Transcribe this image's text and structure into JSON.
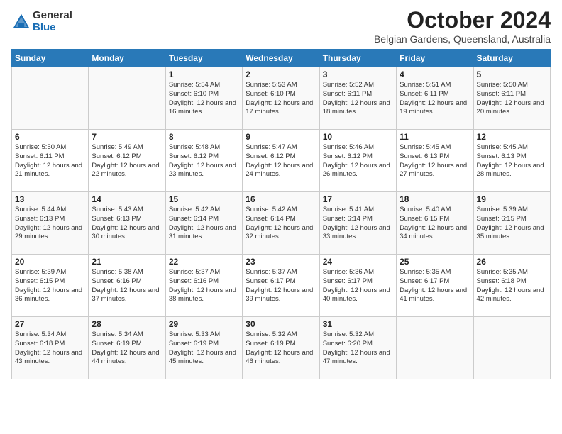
{
  "logo": {
    "general": "General",
    "blue": "Blue"
  },
  "header": {
    "month": "October 2024",
    "location": "Belgian Gardens, Queensland, Australia"
  },
  "weekdays": [
    "Sunday",
    "Monday",
    "Tuesday",
    "Wednesday",
    "Thursday",
    "Friday",
    "Saturday"
  ],
  "weeks": [
    [
      {
        "day": "",
        "info": ""
      },
      {
        "day": "",
        "info": ""
      },
      {
        "day": "1",
        "info": "Sunrise: 5:54 AM\nSunset: 6:10 PM\nDaylight: 12 hours and 16 minutes."
      },
      {
        "day": "2",
        "info": "Sunrise: 5:53 AM\nSunset: 6:10 PM\nDaylight: 12 hours and 17 minutes."
      },
      {
        "day": "3",
        "info": "Sunrise: 5:52 AM\nSunset: 6:11 PM\nDaylight: 12 hours and 18 minutes."
      },
      {
        "day": "4",
        "info": "Sunrise: 5:51 AM\nSunset: 6:11 PM\nDaylight: 12 hours and 19 minutes."
      },
      {
        "day": "5",
        "info": "Sunrise: 5:50 AM\nSunset: 6:11 PM\nDaylight: 12 hours and 20 minutes."
      }
    ],
    [
      {
        "day": "6",
        "info": "Sunrise: 5:50 AM\nSunset: 6:11 PM\nDaylight: 12 hours and 21 minutes."
      },
      {
        "day": "7",
        "info": "Sunrise: 5:49 AM\nSunset: 6:12 PM\nDaylight: 12 hours and 22 minutes."
      },
      {
        "day": "8",
        "info": "Sunrise: 5:48 AM\nSunset: 6:12 PM\nDaylight: 12 hours and 23 minutes."
      },
      {
        "day": "9",
        "info": "Sunrise: 5:47 AM\nSunset: 6:12 PM\nDaylight: 12 hours and 24 minutes."
      },
      {
        "day": "10",
        "info": "Sunrise: 5:46 AM\nSunset: 6:12 PM\nDaylight: 12 hours and 26 minutes."
      },
      {
        "day": "11",
        "info": "Sunrise: 5:45 AM\nSunset: 6:13 PM\nDaylight: 12 hours and 27 minutes."
      },
      {
        "day": "12",
        "info": "Sunrise: 5:45 AM\nSunset: 6:13 PM\nDaylight: 12 hours and 28 minutes."
      }
    ],
    [
      {
        "day": "13",
        "info": "Sunrise: 5:44 AM\nSunset: 6:13 PM\nDaylight: 12 hours and 29 minutes."
      },
      {
        "day": "14",
        "info": "Sunrise: 5:43 AM\nSunset: 6:13 PM\nDaylight: 12 hours and 30 minutes."
      },
      {
        "day": "15",
        "info": "Sunrise: 5:42 AM\nSunset: 6:14 PM\nDaylight: 12 hours and 31 minutes."
      },
      {
        "day": "16",
        "info": "Sunrise: 5:42 AM\nSunset: 6:14 PM\nDaylight: 12 hours and 32 minutes."
      },
      {
        "day": "17",
        "info": "Sunrise: 5:41 AM\nSunset: 6:14 PM\nDaylight: 12 hours and 33 minutes."
      },
      {
        "day": "18",
        "info": "Sunrise: 5:40 AM\nSunset: 6:15 PM\nDaylight: 12 hours and 34 minutes."
      },
      {
        "day": "19",
        "info": "Sunrise: 5:39 AM\nSunset: 6:15 PM\nDaylight: 12 hours and 35 minutes."
      }
    ],
    [
      {
        "day": "20",
        "info": "Sunrise: 5:39 AM\nSunset: 6:15 PM\nDaylight: 12 hours and 36 minutes."
      },
      {
        "day": "21",
        "info": "Sunrise: 5:38 AM\nSunset: 6:16 PM\nDaylight: 12 hours and 37 minutes."
      },
      {
        "day": "22",
        "info": "Sunrise: 5:37 AM\nSunset: 6:16 PM\nDaylight: 12 hours and 38 minutes."
      },
      {
        "day": "23",
        "info": "Sunrise: 5:37 AM\nSunset: 6:17 PM\nDaylight: 12 hours and 39 minutes."
      },
      {
        "day": "24",
        "info": "Sunrise: 5:36 AM\nSunset: 6:17 PM\nDaylight: 12 hours and 40 minutes."
      },
      {
        "day": "25",
        "info": "Sunrise: 5:35 AM\nSunset: 6:17 PM\nDaylight: 12 hours and 41 minutes."
      },
      {
        "day": "26",
        "info": "Sunrise: 5:35 AM\nSunset: 6:18 PM\nDaylight: 12 hours and 42 minutes."
      }
    ],
    [
      {
        "day": "27",
        "info": "Sunrise: 5:34 AM\nSunset: 6:18 PM\nDaylight: 12 hours and 43 minutes."
      },
      {
        "day": "28",
        "info": "Sunrise: 5:34 AM\nSunset: 6:19 PM\nDaylight: 12 hours and 44 minutes."
      },
      {
        "day": "29",
        "info": "Sunrise: 5:33 AM\nSunset: 6:19 PM\nDaylight: 12 hours and 45 minutes."
      },
      {
        "day": "30",
        "info": "Sunrise: 5:32 AM\nSunset: 6:19 PM\nDaylight: 12 hours and 46 minutes."
      },
      {
        "day": "31",
        "info": "Sunrise: 5:32 AM\nSunset: 6:20 PM\nDaylight: 12 hours and 47 minutes."
      },
      {
        "day": "",
        "info": ""
      },
      {
        "day": "",
        "info": ""
      }
    ]
  ]
}
